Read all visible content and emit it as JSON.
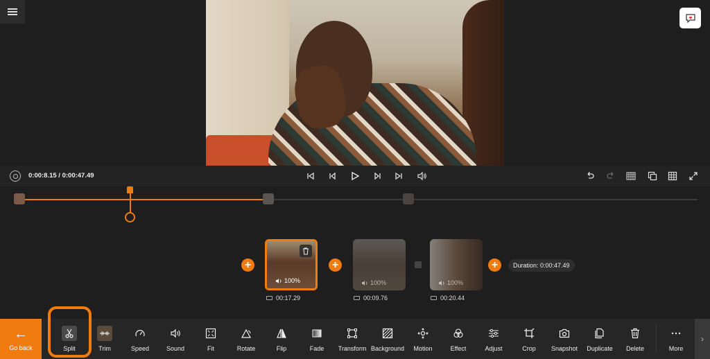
{
  "playback": {
    "time_display": "0:00:8.15 / 0:00:47.49"
  },
  "clips": [
    {
      "volume": "100%",
      "duration": "00:17.29",
      "active": true
    },
    {
      "volume": "100%",
      "duration": "00:09.76",
      "active": false
    },
    {
      "volume": "100%",
      "duration": "00:20.44",
      "active": false
    }
  ],
  "total_duration": "Duration: 0:00:47.49",
  "toolbar": {
    "go_back": "Go back",
    "split": "Split",
    "trim": "Trim",
    "speed": "Speed",
    "sound": "Sound",
    "fit": "Fit",
    "rotate": "Rotate",
    "flip": "Flip",
    "fade": "Fade",
    "transform": "Transform",
    "background": "Background",
    "motion": "Motion",
    "effect": "Effect",
    "adjust": "Adjust",
    "crop": "Crop",
    "snapshot": "Snapshot",
    "duplicate": "Duplicate",
    "delete": "Delete",
    "more": "More"
  },
  "colors": {
    "accent": "#f07c10",
    "background": "#1e1e1e",
    "toolbar": "#262626"
  }
}
